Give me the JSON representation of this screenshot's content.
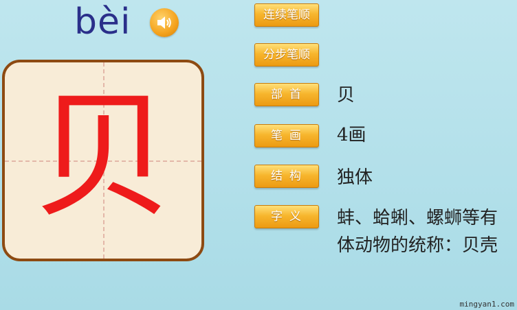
{
  "pinyin": "bèi",
  "speaker_icon": "speaker-icon",
  "character": "贝",
  "buttons": {
    "continuous_strokes": "连续笔顺",
    "step_strokes": "分步笔顺"
  },
  "info": [
    {
      "label": "部首",
      "value": "贝"
    },
    {
      "label": "笔画",
      "value": "4画"
    },
    {
      "label": "结构",
      "value": "独体"
    },
    {
      "label": "字义",
      "lines": [
        "蚌、蛤蜊、螺蛳等有",
        "体动物的统称：贝壳"
      ]
    }
  ],
  "watermark": "mingyan1.com",
  "colors": {
    "accent": "#f4a21c",
    "character": "#ee1b1b",
    "pinyin": "#2a2f8a",
    "border": "#8d4a12"
  }
}
